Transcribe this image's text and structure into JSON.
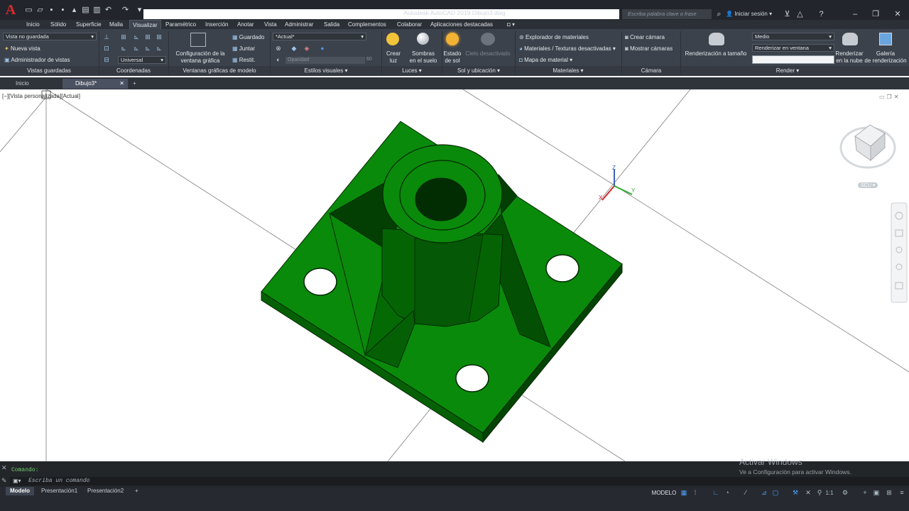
{
  "app": {
    "title": "Autodesk AutoCAD 2019   Dibujo3.dwg",
    "logo": "A",
    "search_placeholder": "Escriba palabra clave o frase",
    "signin": "Iniciar sesión"
  },
  "menu": [
    "Inicio",
    "Sólido",
    "Superficie",
    "Malla",
    "Visualizar",
    "Paramétrico",
    "Inserción",
    "Anotar",
    "Vista",
    "Administrar",
    "Salida",
    "Complementos",
    "Colaborar",
    "Aplicaciones destacadas"
  ],
  "ribbon": {
    "saved_views": {
      "dropdown": "Vista no guardada",
      "new_view": "Nueva vista",
      "view_manager": "Administrador de vistas",
      "title": "Vistas guardadas"
    },
    "coordinates": {
      "ucs": "Universal",
      "title": "Coordenadas"
    },
    "viewports": {
      "config_line1": "Configuración de la",
      "config_line2": "ventana gráfica",
      "saved": "Guardado",
      "join": "Juntar",
      "restore": "Restit.",
      "title": "Ventanas gráficas de modelo"
    },
    "visual_styles": {
      "style": "*Actual*",
      "opacity": "Opacidad",
      "opacity_value": "60",
      "title": "Estilos visuales"
    },
    "lights": {
      "create_line1": "Crear",
      "create_line2": "luz",
      "shadows_line1": "Sombras",
      "shadows_line2": "en el suelo",
      "title": "Luces"
    },
    "sun": {
      "status_line1": "Estado",
      "status_line2": "de sol",
      "sky_off": "Cielo desactivado",
      "title": "Sol y ubicación"
    },
    "materials": {
      "explorer": "Explorador de materiales",
      "textures": "Materiales / Texturas desactivadas",
      "map": "Mapa de material",
      "title": "Materiales"
    },
    "camera": {
      "create": "Crear cámara",
      "show": "Mostrar cámaras",
      "title": "Cámara"
    },
    "render": {
      "size": "Renderización a tamaño",
      "quality": "Medio",
      "target": "Renderizar en ventana",
      "cloud_line1": "Renderizar",
      "cloud_line2": "en la nube",
      "gallery_line1": "Galería",
      "gallery_line2": "de renderización",
      "title": "Render"
    }
  },
  "file_tabs": [
    "Inicio",
    "Dibujo3*"
  ],
  "viewport": {
    "label": "[−][Vista personalizada][Actual]",
    "ucs_label": "SCU",
    "axis_x": "X",
    "axis_y": "Y",
    "axis_z": "Z"
  },
  "command": {
    "history": "Comando:",
    "placeholder": "Escriba un comando"
  },
  "layout_tabs": [
    "Modelo",
    "Presentación1",
    "Presentación2"
  ],
  "status": {
    "mode": "MODELO",
    "scale": "1:1"
  },
  "watermark": {
    "line1": "Activar Windows",
    "line2": "Ve a Configuración para activar Windows."
  },
  "colors": {
    "part_face": "#0a8a0a",
    "part_side": "#056005",
    "part_dark": "#033f03",
    "logo": "#e0292b"
  }
}
